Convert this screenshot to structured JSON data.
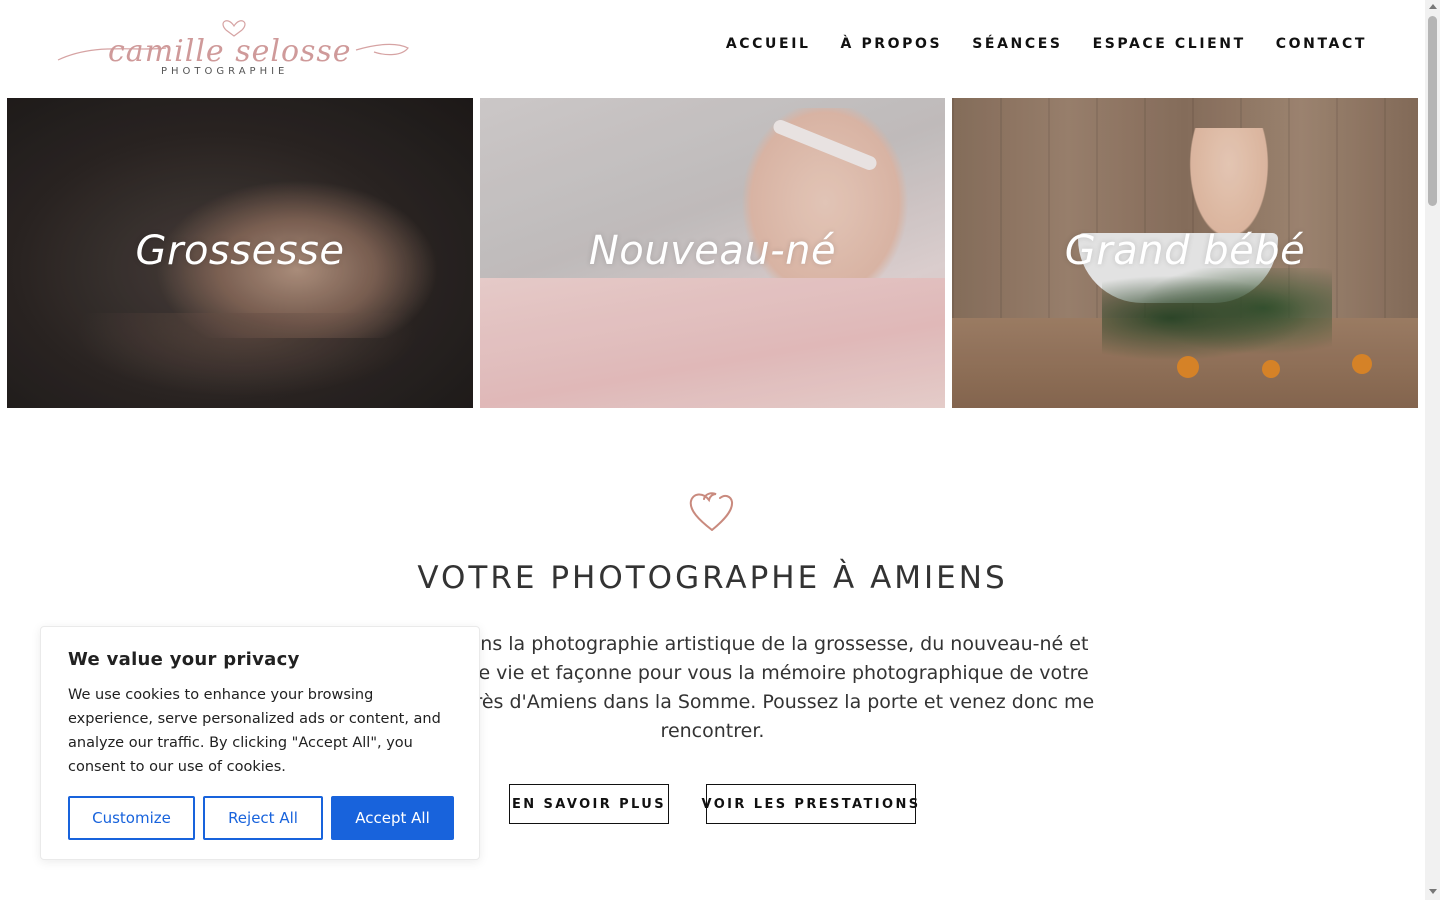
{
  "brand": {
    "logo_script": "camille selosse",
    "logo_sub": "PHOTOGRAPHIE"
  },
  "nav": {
    "items": [
      {
        "label": "ACCUEIL"
      },
      {
        "label": "À PROPOS"
      },
      {
        "label": "SÉANCES"
      },
      {
        "label": "ESPACE CLIENT"
      },
      {
        "label": "CONTACT"
      }
    ]
  },
  "tiles": [
    {
      "label": "Grossesse"
    },
    {
      "label": "Nouveau-né"
    },
    {
      "label": "Grand bébé"
    }
  ],
  "icons": {
    "section_heart": "heart-icon"
  },
  "main": {
    "title": "VOTRE PHOTOGRAPHE À AMIENS",
    "intro_line1": "…pécialisée dans la photographie artistique de la grossesse, du nouveau-né et",
    "intro_line2": "…ux instants de vie et façonne pour vous la mémoire photographique de votre",
    "intro_line3": "…mon studio près d'Amiens dans la Somme. Poussez la porte et venez donc me",
    "intro_line4": "rencontrer.",
    "btn_more": "EN SAVOIR PLUS",
    "btn_services": "VOIR LES PRESTATIONS"
  },
  "cookie": {
    "title": "We value your privacy",
    "text": "We use cookies to enhance your browsing experience, serve personalized ads or content, and analyze our traffic. By clicking \"Accept All\", you consent to our use of cookies.",
    "customize": "Customize",
    "reject": "Reject All",
    "accept": "Accept All"
  },
  "colors": {
    "accent": "#1863dc",
    "logo_pink": "#cf9a9a",
    "heart": "#c98a7e"
  }
}
